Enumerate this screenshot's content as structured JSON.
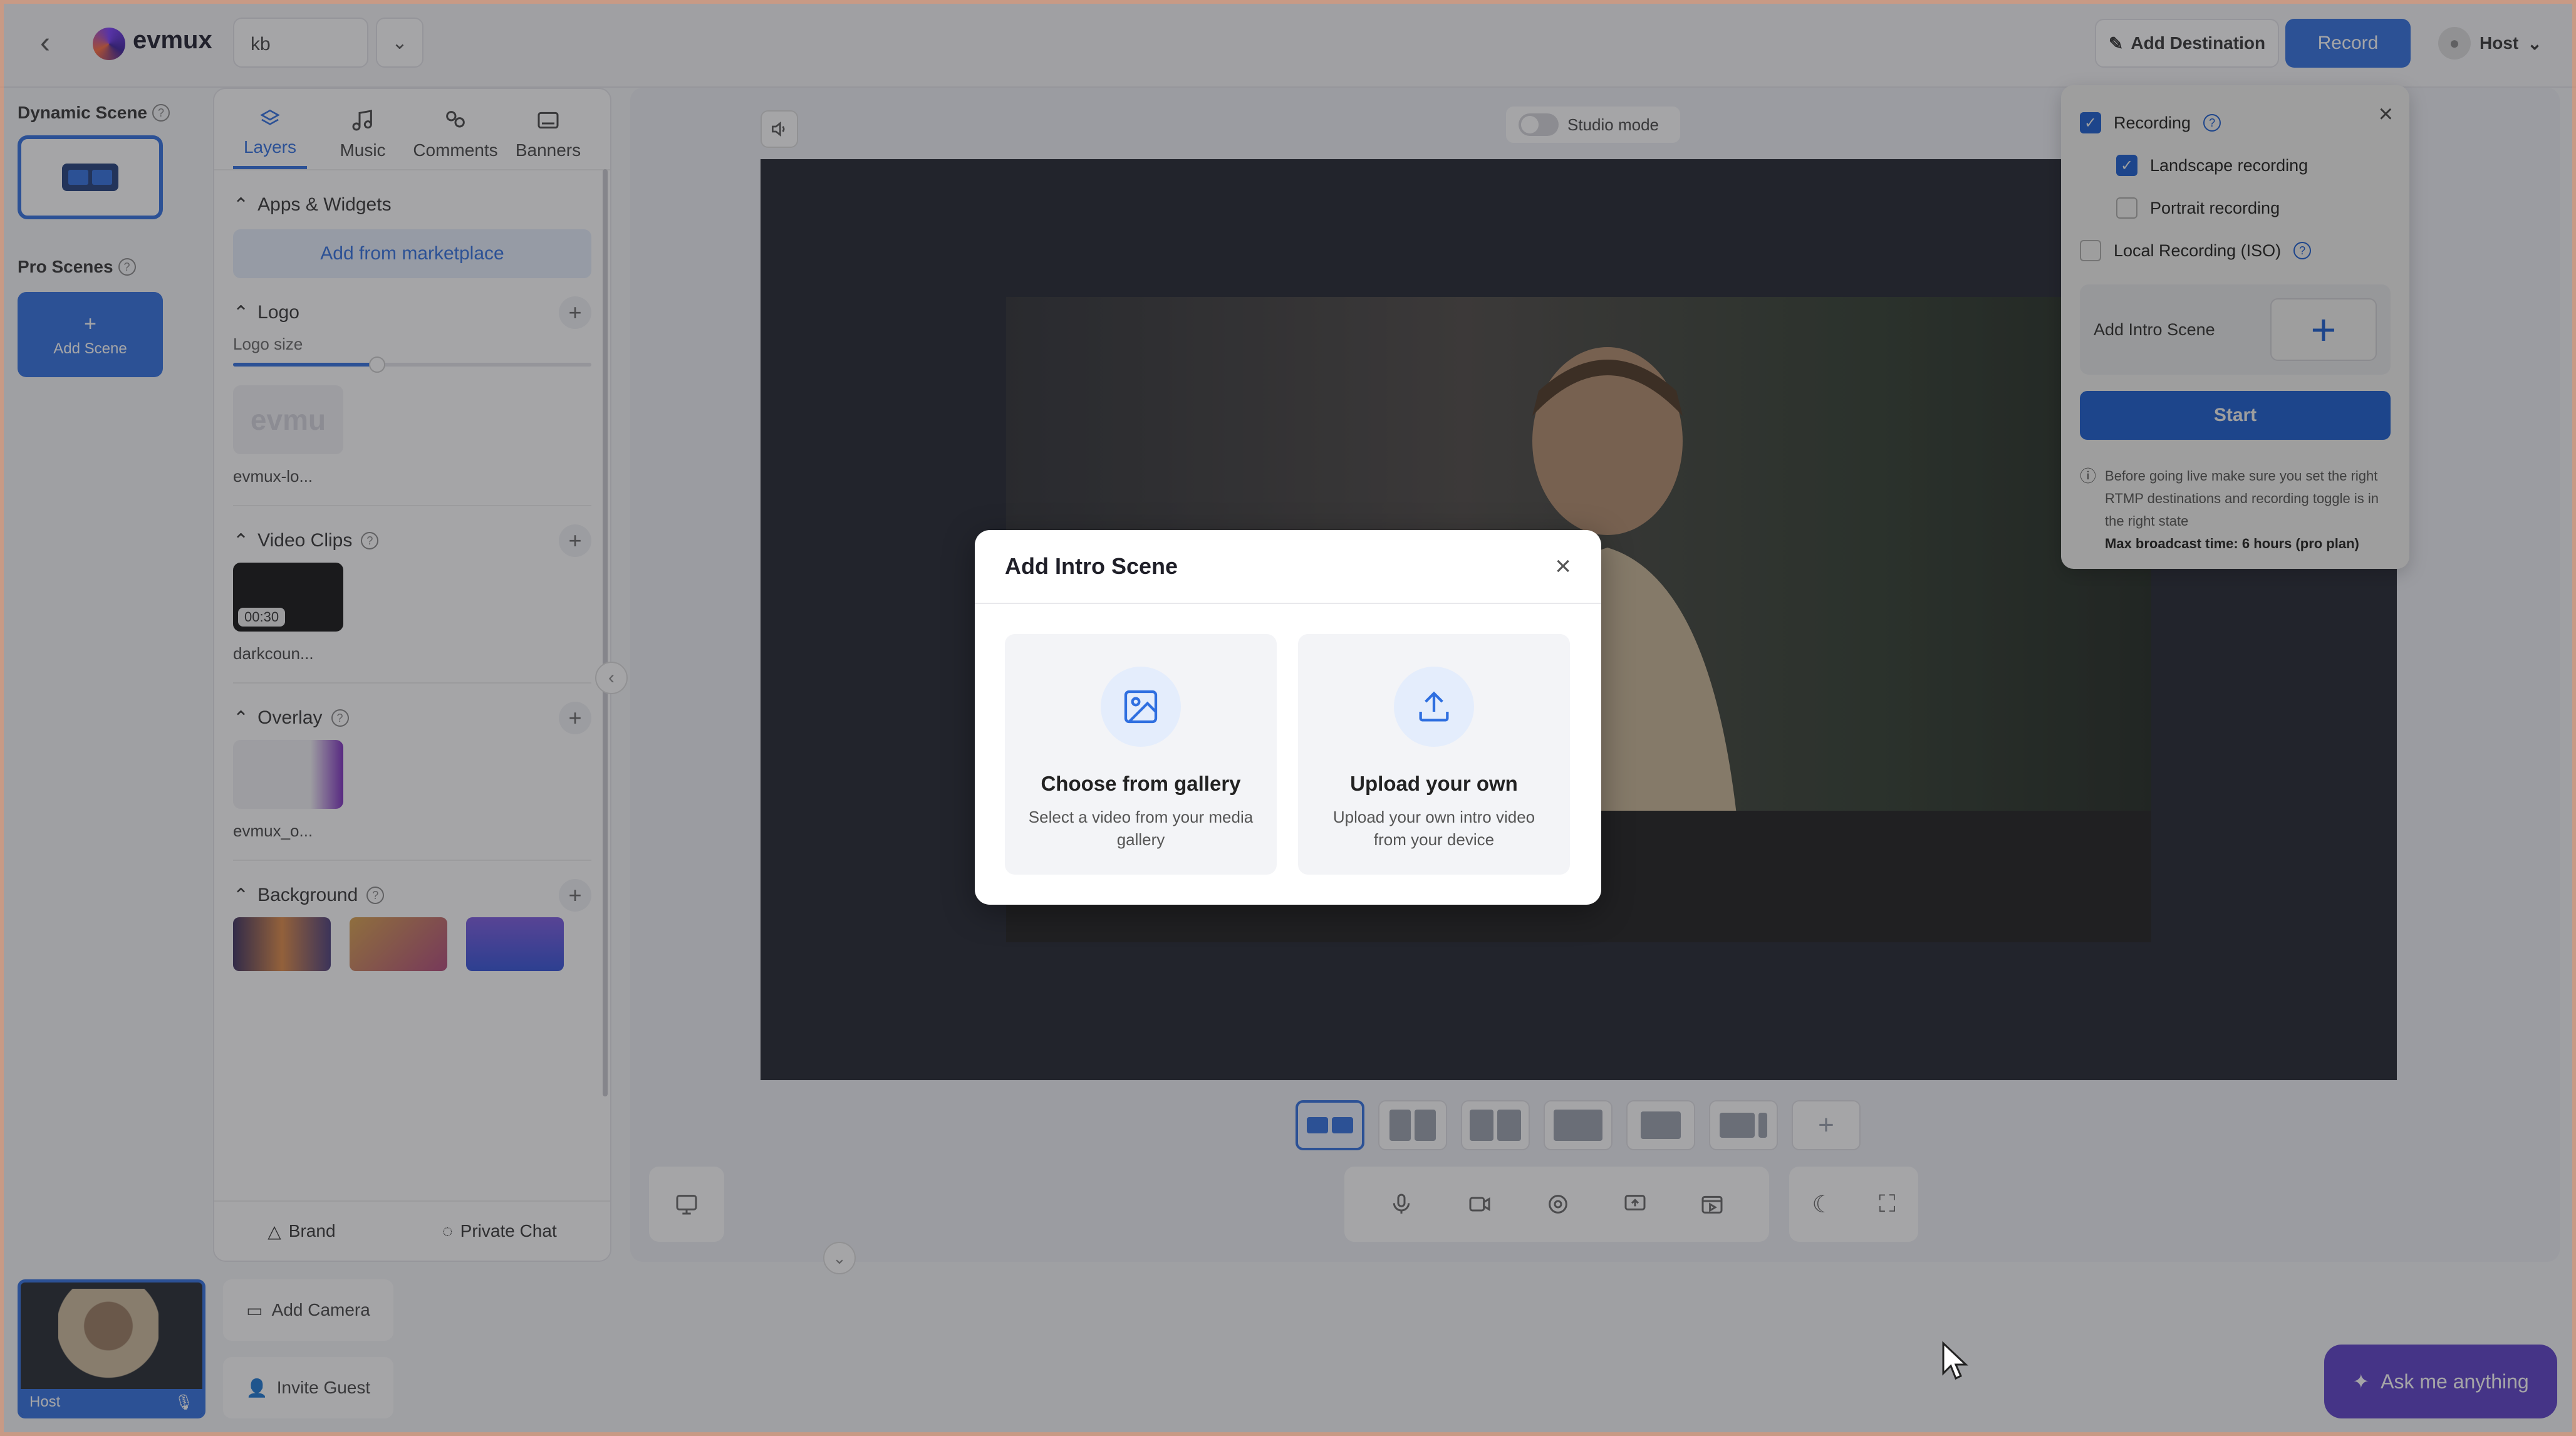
{
  "header": {
    "app_name": "evmux",
    "studio_name": "kb",
    "add_destination": "Add Destination",
    "record": "Record",
    "host": "Host"
  },
  "scenes": {
    "dynamic_label": "Dynamic Scene",
    "pro_label": "Pro Scenes",
    "add_scene": "Add Scene"
  },
  "panel": {
    "tabs": [
      {
        "label": "Layers",
        "icon": "layers-icon",
        "active": true
      },
      {
        "label": "Music",
        "icon": "music-icon"
      },
      {
        "label": "Comments",
        "icon": "comments-icon"
      },
      {
        "label": "Banners",
        "icon": "banners-icon"
      }
    ],
    "apps_widgets": "Apps & Widgets",
    "marketplace": "Add from marketplace",
    "logo": "Logo",
    "logo_size": "Logo size",
    "logo_slider_value": 0.4,
    "logo_asset": "evmux-lo...",
    "video_clips": "Video Clips",
    "clip_duration": "00:30",
    "clip_name": "darkcoun...",
    "overlay": "Overlay",
    "overlay_name": "evmux_o...",
    "background": "Background",
    "brand": "Brand",
    "private_chat": "Private Chat"
  },
  "stage": {
    "studio_mode": "Studio mode"
  },
  "bottom": {
    "host_label": "Host",
    "add_camera": "Add Camera",
    "invite_guest": "Invite Guest",
    "ask": "Ask me anything"
  },
  "recording_popover": {
    "recording": "Recording",
    "landscape": "Landscape recording",
    "portrait": "Portrait recording",
    "local": "Local Recording (ISO)",
    "add_intro": "Add Intro Scene",
    "start": "Start",
    "note": "Before going live make sure you set the right RTMP destinations and recording toggle is in the right state",
    "note_bold": "Max broadcast time: 6 hours (pro plan)"
  },
  "modal": {
    "title": "Add Intro Scene",
    "gallery_title": "Choose from gallery",
    "gallery_desc": "Select a video from your media gallery",
    "upload_title": "Upload your own",
    "upload_desc": "Upload your own intro video from your device"
  },
  "colors": {
    "accent": "#2f6fe0",
    "ask_button": "#5b3dc9"
  }
}
